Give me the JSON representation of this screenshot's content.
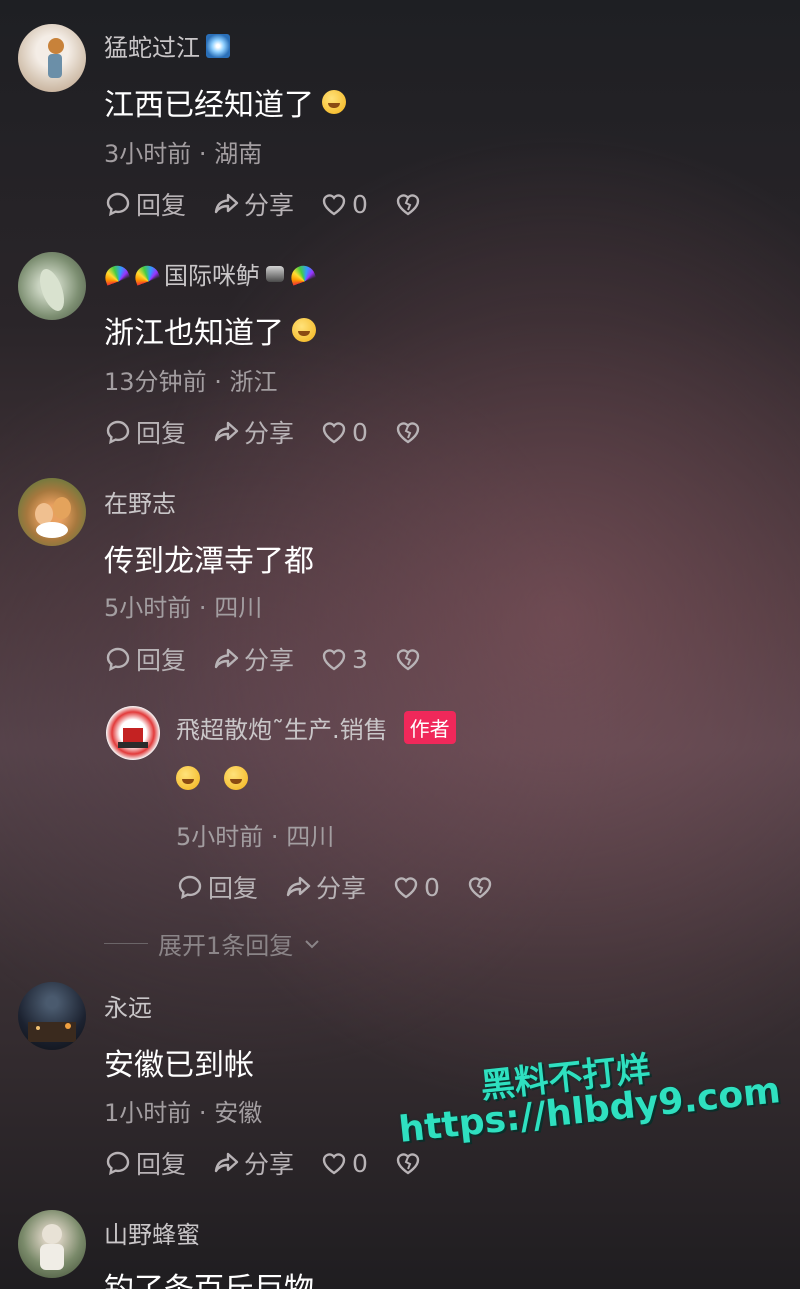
{
  "comments": [
    {
      "username": "猛蛇过江",
      "text": "江西已经知道了",
      "time": "3小时前",
      "location": "湖南",
      "reply_label": "回复",
      "share_label": "分享",
      "like_count": "0"
    },
    {
      "username": "国际咪鲈",
      "text": "浙江也知道了",
      "time": "13分钟前",
      "location": "浙江",
      "reply_label": "回复",
      "share_label": "分享",
      "like_count": "0"
    },
    {
      "username": "在野志",
      "text": "传到龙潭寺了都",
      "time": "5小时前",
      "location": "四川",
      "reply_label": "回复",
      "share_label": "分享",
      "like_count": "3"
    },
    {
      "username": "永远",
      "text": "安徽已到帐",
      "time": "1小时前",
      "location": "安徽",
      "reply_label": "回复",
      "share_label": "分享",
      "like_count": "0"
    },
    {
      "username": "山野蜂蜜",
      "text": "钓了条百斤巨物"
    }
  ],
  "reply": {
    "username": "飛超散炮˜生产.销售",
    "author_badge": "作者",
    "time": "5小时前",
    "location": "四川",
    "reply_label": "回复",
    "share_label": "分享",
    "like_count": "0"
  },
  "expand_replies": "展开1条回复",
  "separator": "·",
  "watermark": {
    "line1": "黑料不打烊",
    "line2": "https://hlbdy9.com"
  },
  "icons": {
    "reply": "speech-bubble-icon",
    "share": "share-arrow-icon",
    "like": "heart-icon",
    "dislike": "broken-heart-icon"
  }
}
